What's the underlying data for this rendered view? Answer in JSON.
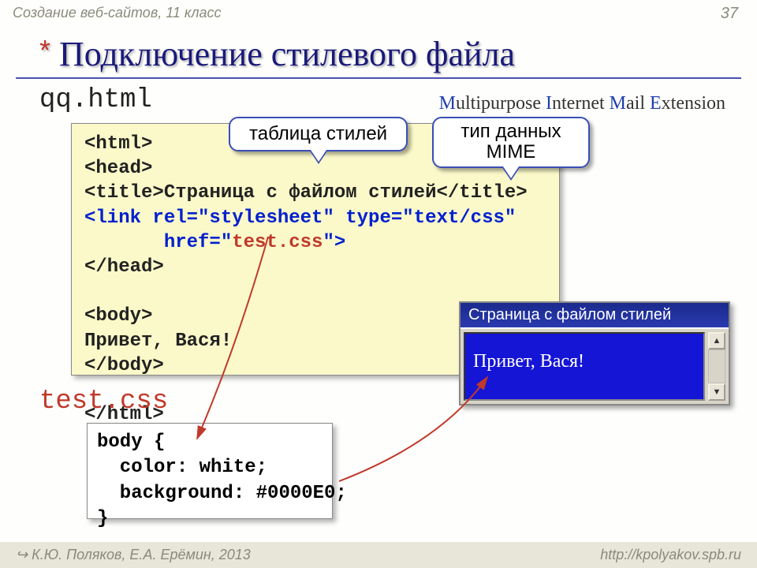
{
  "header": "Создание веб-сайтов, 11 класс",
  "page_number": "37",
  "title": "Подключение стилевого файла",
  "filename_html": "qq.html",
  "mime": {
    "m": "M",
    "ultipurpose": "ultipurpose ",
    "i": "I",
    "nternet": "nternet ",
    "ma": "M",
    "ail": "ail ",
    "e": "E",
    "xtension": "xtension"
  },
  "callouts": {
    "stylesheet": "таблица стилей",
    "mime": "тип данных MIME"
  },
  "code_html": {
    "l1": "<html>",
    "l2": "<head>",
    "l3a": "<title>",
    "l3b": "Страница с файлом стилей",
    "l3c": "</title>",
    "l4": "<link rel=\"stylesheet\" type=\"text/css\"",
    "l5a": "       href=\"",
    "l5b": "test.css",
    "l5c": "\">",
    "l6": "</head>",
    "l7": "<body>",
    "l8": "Привет, Вася!",
    "l9": "</body>",
    "l10": "</html>"
  },
  "filename_css": "test.css",
  "code_css": "body {\n  color: white;\n  background: #0000E0;\n}",
  "preview": {
    "title": "Страница с файлом стилей",
    "body": "Привет, Вася!"
  },
  "footer": {
    "left": "↪ К.Ю. Поляков, Е.А. Ерёмин, 2013",
    "right": "http://kpolyakov.spb.ru"
  },
  "scroll": {
    "up": "▲",
    "down": "▼"
  }
}
